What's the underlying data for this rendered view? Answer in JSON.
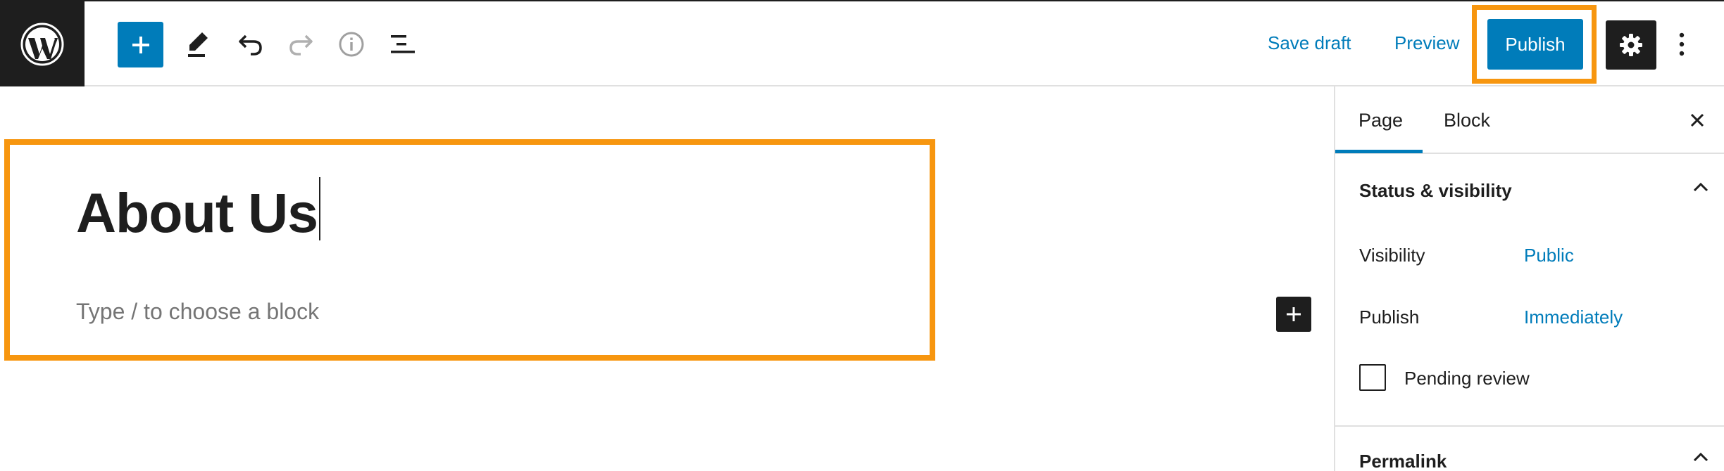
{
  "toolbar": {
    "logo_icon": "wordpress-logo-icon",
    "add_block_icon": "plus-icon",
    "tools_icon": "pencil-icon",
    "undo_icon": "undo-icon",
    "redo_icon": "redo-icon",
    "details_icon": "info-icon",
    "outline_icon": "list-view-icon",
    "save_draft_label": "Save draft",
    "preview_label": "Preview",
    "publish_label": "Publish",
    "settings_icon": "gear-icon",
    "more_icon": "more-vertical-icon",
    "accent_color": "#007cba",
    "highlight_color": "#f7960f"
  },
  "editor": {
    "title": "About Us",
    "block_placeholder": "Type / to choose a block",
    "inline_add_icon": "plus-icon"
  },
  "sidebar": {
    "tabs": [
      {
        "label": "Page",
        "active": true
      },
      {
        "label": "Block",
        "active": false
      }
    ],
    "close_icon": "close-icon",
    "status_panel": {
      "title": "Status & visibility",
      "expanded": true,
      "rows": [
        {
          "label": "Visibility",
          "value": "Public"
        },
        {
          "label": "Publish",
          "value": "Immediately"
        }
      ],
      "pending_review_label": "Pending review",
      "pending_review_checked": false
    },
    "permalink_panel": {
      "title": "Permalink",
      "expanded": true
    }
  }
}
